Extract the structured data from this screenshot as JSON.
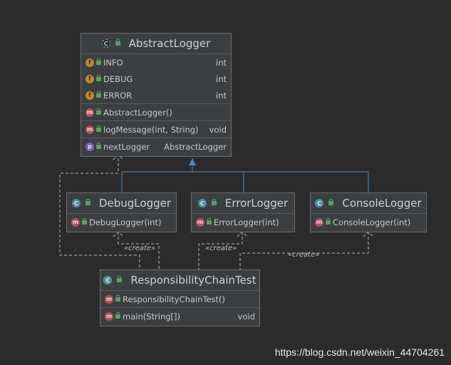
{
  "classes": {
    "abstract_logger": {
      "name": "AbstractLogger",
      "fields": [
        {
          "name": "INFO",
          "type": "int"
        },
        {
          "name": "DEBUG",
          "type": "int"
        },
        {
          "name": "ERROR",
          "type": "int"
        }
      ],
      "constructor": "AbstractLogger()",
      "method": {
        "name": "logMessage(int, String)",
        "type": "void"
      },
      "property": {
        "name": "nextLogger",
        "type": "AbstractLogger"
      }
    },
    "debug_logger": {
      "name": "DebugLogger",
      "constructor": "DebugLogger(int)"
    },
    "error_logger": {
      "name": "ErrorLogger",
      "constructor": "ErrorLogger(int)"
    },
    "console_logger": {
      "name": "ConsoleLogger",
      "constructor": "ConsoleLogger(int)"
    },
    "test": {
      "name": "ResponsibilityChainTest",
      "constructor": "ResponsibilityChainTest()",
      "method": {
        "name": "main(String[])",
        "type": "void"
      }
    }
  },
  "stereotypes": {
    "create": "«create»"
  },
  "icons": {
    "class": "C",
    "field": "f",
    "method": "m",
    "property": "p"
  },
  "colors": {
    "background": "#2b2b2b",
    "inheritance_arrow": "#4a88c7",
    "dependency_line": "#bbbbbb"
  },
  "watermark": "https://blog.csdn.net/weixin_44704261"
}
